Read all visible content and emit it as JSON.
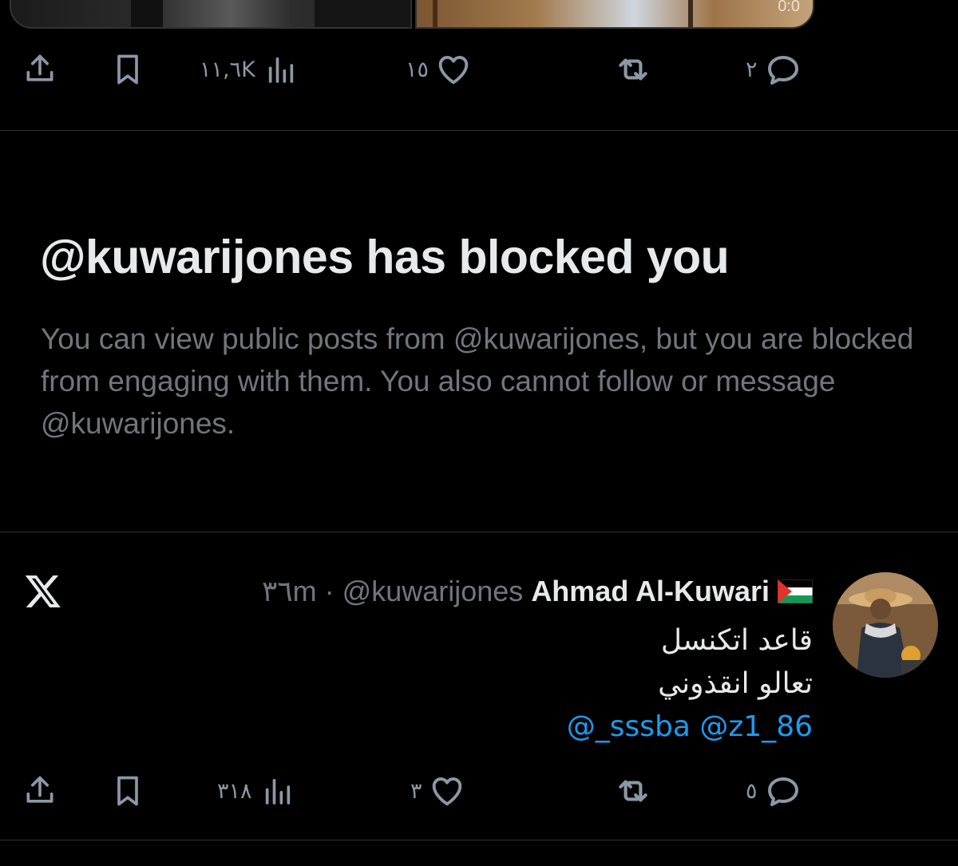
{
  "top_media": {
    "overlay_text": "0:0"
  },
  "top_actions": {
    "views": "١١,٦K",
    "likes": "١٥",
    "reposts": "",
    "replies": "٢"
  },
  "blocked_notice": {
    "title": "@kuwarijones has blocked you",
    "description": "You can view public posts from @kuwarijones, but you are blocked from engaging with them. You also cannot follow or message @kuwarijones."
  },
  "tweet": {
    "name": "Ahmad Al-Kuwari",
    "flag_icon": "palestine-flag-icon",
    "handle": "@kuwarijones",
    "separator": "·",
    "time": "٣٦m",
    "lines": [
      "قاعد اتكنسل",
      "تعالو انقذوني"
    ],
    "mentions": "@_sssba @z1_86",
    "actions": {
      "views": "٣١٨",
      "likes": "٣",
      "reposts": "",
      "replies": "٥"
    }
  },
  "colors": {
    "background": "#000000",
    "text_primary": "#e7e9ea",
    "text_secondary": "#71767b",
    "link": "#1d9bf0",
    "divider": "#2f3336"
  }
}
